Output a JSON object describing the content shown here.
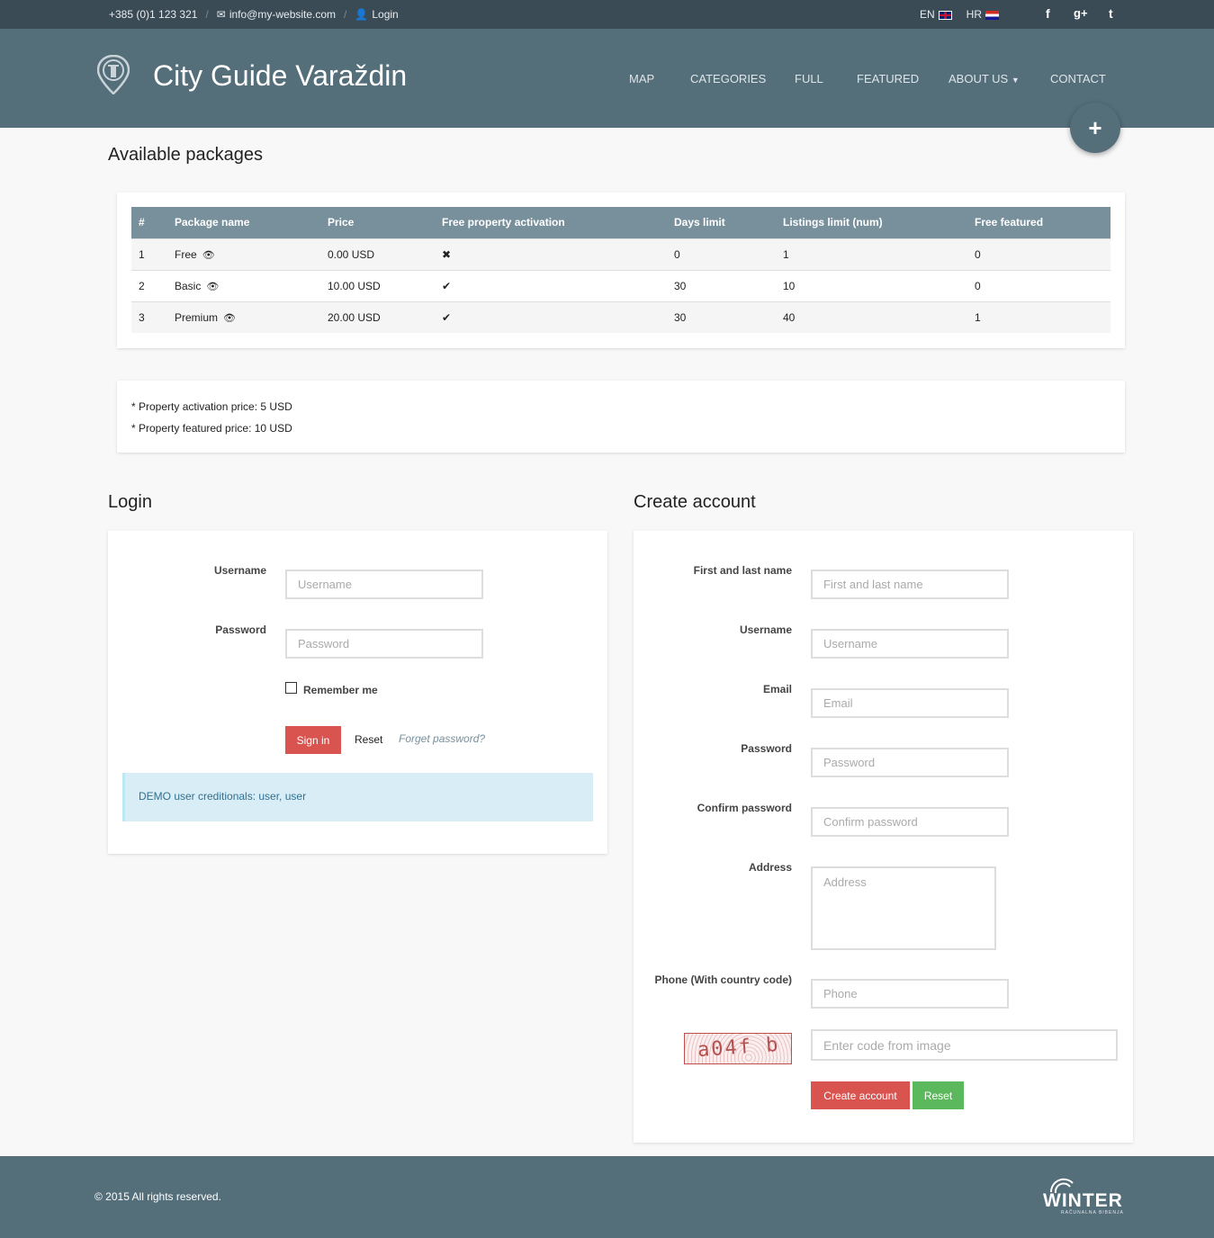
{
  "topbar": {
    "phone": "+385 (0)1 123 321",
    "email": "info@my-website.com",
    "login": "Login",
    "lang_en": "EN",
    "lang_hr": "HR",
    "facebook": "f",
    "gplus": "g+",
    "twitter": "t"
  },
  "header": {
    "title": "City Guide Varaždin",
    "nav": [
      "MAP",
      "CATEGORIES",
      "FULL",
      "FEATURED",
      "ABOUT US",
      "CONTACT"
    ],
    "add_label": "+"
  },
  "packages": {
    "heading": "Available packages",
    "columns": [
      "#",
      "Package name",
      "Price",
      "Free property activation",
      "Days limit",
      "Listings limit (num)",
      "Free featured"
    ],
    "rows": [
      {
        "num": "1",
        "name": "Free",
        "price": "0.00 USD",
        "activation": "✖",
        "days": "0",
        "listings": "1",
        "featured": "0"
      },
      {
        "num": "2",
        "name": "Basic",
        "price": "10.00 USD",
        "activation": "✔",
        "days": "30",
        "listings": "10",
        "featured": "0"
      },
      {
        "num": "3",
        "name": "Premium",
        "price": "20.00 USD",
        "activation": "✔",
        "days": "30",
        "listings": "40",
        "featured": "1"
      }
    ],
    "notes": [
      "* Property activation price: 5 USD",
      "* Property featured price: 10 USD"
    ]
  },
  "login": {
    "heading": "Login",
    "username_label": "Username",
    "username_placeholder": "Username",
    "password_label": "Password",
    "password_placeholder": "Password",
    "remember": "Remember me",
    "signin": "Sign in",
    "reset": "Reset",
    "forget": "Forget password?",
    "demo": "DEMO user creditionals: user, user"
  },
  "register": {
    "heading": "Create account",
    "fields": [
      {
        "label": "First and last name",
        "placeholder": "First and last name"
      },
      {
        "label": "Username",
        "placeholder": "Username"
      },
      {
        "label": "Email",
        "placeholder": "Email"
      },
      {
        "label": "Password",
        "placeholder": "Password"
      },
      {
        "label": "Confirm password",
        "placeholder": "Confirm password"
      },
      {
        "label": "Address",
        "placeholder": "Address"
      },
      {
        "label": "Phone (With country code)",
        "placeholder": "Phone"
      }
    ],
    "captcha_text": "a04f b",
    "captcha_placeholder": "Enter code from image",
    "create": "Create account",
    "reset": "Reset"
  },
  "footer": {
    "copyright": "© 2015 All rights reserved.",
    "brand": "WINTER",
    "brand_sub": "RAČUNALNA BIBENJA"
  }
}
